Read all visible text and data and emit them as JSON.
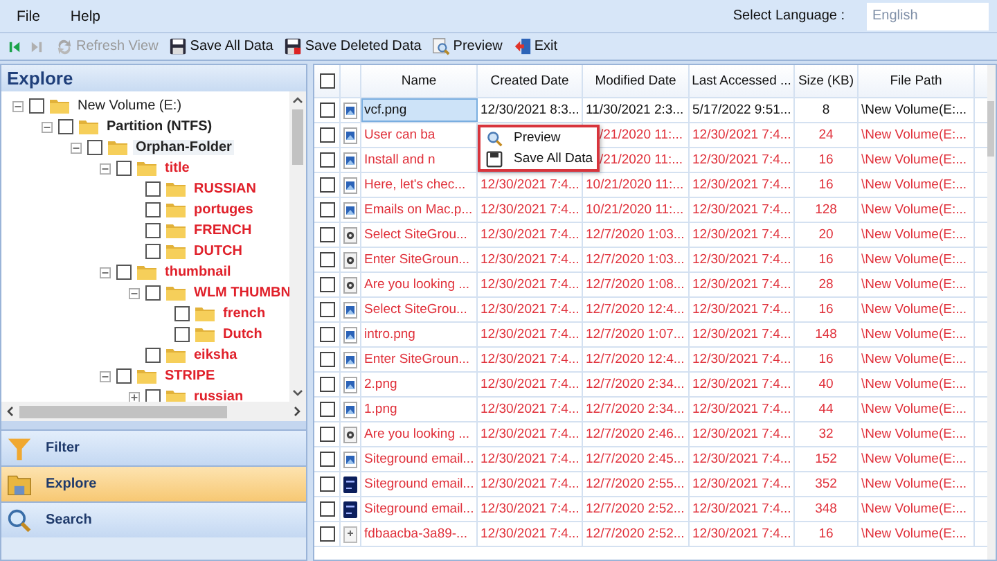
{
  "menu": [
    "File",
    "Help"
  ],
  "language": {
    "label": "Select Language :",
    "value": "English"
  },
  "toolbar": [
    {
      "kind": "first",
      "disabled": false
    },
    {
      "kind": "last",
      "disabled": true
    },
    {
      "kind": "refresh",
      "label": "Refresh View",
      "disabled": true
    },
    {
      "kind": "save",
      "label": "Save All Data",
      "disabled": false
    },
    {
      "kind": "save-deleted",
      "label": "Save Deleted Data",
      "disabled": false
    },
    {
      "kind": "preview",
      "label": "Preview",
      "disabled": false
    },
    {
      "kind": "exit",
      "label": "Exit",
      "disabled": false
    }
  ],
  "explore_panel": {
    "title": "Explore",
    "tree": [
      {
        "label": "New Volume (E:)",
        "deleted": false,
        "checked": false,
        "expanded": true,
        "selected": false,
        "children": [
          {
            "label": "Partition (NTFS)",
            "deleted": false,
            "checked": false,
            "expanded": true,
            "selected": false,
            "children": [
              {
                "label": "Orphan-Folder",
                "deleted": false,
                "checked": false,
                "expanded": true,
                "selected": true,
                "children": [
                  {
                    "label": "title",
                    "deleted": true,
                    "checked": false,
                    "expanded": true,
                    "selected": false,
                    "children": [
                      {
                        "label": "RUSSIAN",
                        "deleted": true,
                        "checked": false,
                        "selected": false
                      },
                      {
                        "label": "portuges",
                        "deleted": true,
                        "checked": false,
                        "selected": false
                      },
                      {
                        "label": "FRENCH",
                        "deleted": true,
                        "checked": false,
                        "selected": false
                      },
                      {
                        "label": "DUTCH",
                        "deleted": true,
                        "checked": false,
                        "selected": false
                      }
                    ]
                  },
                  {
                    "label": "thumbnail",
                    "deleted": true,
                    "checked": false,
                    "expanded": true,
                    "selected": false,
                    "children": [
                      {
                        "label": "WLM THUMBN",
                        "deleted": true,
                        "checked": false,
                        "expanded": true,
                        "selected": false,
                        "children": [
                          {
                            "label": "french",
                            "deleted": true,
                            "checked": false,
                            "selected": false
                          },
                          {
                            "label": "Dutch",
                            "deleted": true,
                            "checked": false,
                            "selected": false
                          }
                        ]
                      },
                      {
                        "label": "eiksha",
                        "deleted": true,
                        "checked": false,
                        "selected": false
                      }
                    ]
                  },
                  {
                    "label": "STRIPE",
                    "deleted": true,
                    "checked": false,
                    "expanded": true,
                    "selected": false,
                    "children": [
                      {
                        "label": "russian",
                        "deleted": true,
                        "checked": false,
                        "expanded": false,
                        "selected": false
                      }
                    ]
                  }
                ]
              }
            ]
          }
        ]
      }
    ]
  },
  "nav": [
    {
      "kind": "filter",
      "label": "Filter",
      "selected": false
    },
    {
      "kind": "explore",
      "label": "Explore",
      "selected": true
    },
    {
      "kind": "search",
      "label": "Search",
      "selected": false
    }
  ],
  "table": {
    "all_checked": false,
    "columns": [
      "Name",
      "Created Date",
      "Modified Date",
      "Last Accessed ...",
      "Size (KB)",
      "File Path"
    ],
    "rows": [
      {
        "kind": "image",
        "checked": false,
        "selected": true,
        "deleted": false,
        "name": "vcf.png",
        "created": "12/30/2021 8:3...",
        "modified": "11/30/2021 2:3...",
        "accessed": "5/17/2022 9:51...",
        "size": "8",
        "path": "\\New Volume(E:..."
      },
      {
        "kind": "image",
        "checked": false,
        "selected": false,
        "deleted": true,
        "name": "User can ba",
        "modified": "/21/2020 11:...",
        "accessed": "12/30/2021 7:4...",
        "size": "24",
        "path": "\\New Volume(E:..."
      },
      {
        "kind": "image",
        "checked": false,
        "selected": false,
        "deleted": true,
        "name": "Install and n",
        "modified": "/21/2020 11:...",
        "accessed": "12/30/2021 7:4...",
        "size": "16",
        "path": "\\New Volume(E:..."
      },
      {
        "kind": "image",
        "checked": false,
        "selected": false,
        "deleted": true,
        "name": "Here, let's chec...",
        "created": "12/30/2021 7:4...",
        "modified": "10/21/2020 11:...",
        "accessed": "12/30/2021 7:4...",
        "size": "16",
        "path": "\\New Volume(E:..."
      },
      {
        "kind": "image",
        "checked": false,
        "selected": false,
        "deleted": true,
        "name": "Emails on Mac.p...",
        "created": "12/30/2021 7:4...",
        "modified": "10/21/2020 11:...",
        "accessed": "12/30/2021 7:4...",
        "size": "128",
        "path": "\\New Volume(E:..."
      },
      {
        "kind": "gear",
        "checked": false,
        "selected": false,
        "deleted": true,
        "name": "Select SiteGrou...",
        "created": "12/30/2021 7:4...",
        "modified": "12/7/2020 1:03...",
        "accessed": "12/30/2021 7:4...",
        "size": "20",
        "path": "\\New Volume(E:..."
      },
      {
        "kind": "gear",
        "checked": false,
        "selected": false,
        "deleted": true,
        "name": "Enter SiteGroun...",
        "created": "12/30/2021 7:4...",
        "modified": "12/7/2020 1:03...",
        "accessed": "12/30/2021 7:4...",
        "size": "16",
        "path": "\\New Volume(E:..."
      },
      {
        "kind": "gear",
        "checked": false,
        "selected": false,
        "deleted": true,
        "name": "Are you looking ...",
        "created": "12/30/2021 7:4...",
        "modified": "12/7/2020 1:08...",
        "accessed": "12/30/2021 7:4...",
        "size": "28",
        "path": "\\New Volume(E:..."
      },
      {
        "kind": "image",
        "checked": false,
        "selected": false,
        "deleted": true,
        "name": "Select SiteGrou...",
        "created": "12/30/2021 7:4...",
        "modified": "12/7/2020 12:4...",
        "accessed": "12/30/2021 7:4...",
        "size": "16",
        "path": "\\New Volume(E:..."
      },
      {
        "kind": "image",
        "checked": false,
        "selected": false,
        "deleted": true,
        "name": "intro.png",
        "created": "12/30/2021 7:4...",
        "modified": "12/7/2020 1:07...",
        "accessed": "12/30/2021 7:4...",
        "size": "148",
        "path": "\\New Volume(E:..."
      },
      {
        "kind": "image",
        "checked": false,
        "selected": false,
        "deleted": true,
        "name": "Enter SiteGroun...",
        "created": "12/30/2021 7:4...",
        "modified": "12/7/2020 12:4...",
        "accessed": "12/30/2021 7:4...",
        "size": "16",
        "path": "\\New Volume(E:..."
      },
      {
        "kind": "image",
        "checked": false,
        "selected": false,
        "deleted": true,
        "name": "2.png",
        "created": "12/30/2021 7:4...",
        "modified": "12/7/2020 2:34...",
        "accessed": "12/30/2021 7:4...",
        "size": "40",
        "path": "\\New Volume(E:..."
      },
      {
        "kind": "image",
        "checked": false,
        "selected": false,
        "deleted": true,
        "name": "1.png",
        "created": "12/30/2021 7:4...",
        "modified": "12/7/2020 2:34...",
        "accessed": "12/30/2021 7:4...",
        "size": "44",
        "path": "\\New Volume(E:..."
      },
      {
        "kind": "gear",
        "checked": false,
        "selected": false,
        "deleted": true,
        "name": "Are you looking ...",
        "created": "12/30/2021 7:4...",
        "modified": "12/7/2020 2:46...",
        "accessed": "12/30/2021 7:4...",
        "size": "32",
        "path": "\\New Volume(E:..."
      },
      {
        "kind": "image",
        "checked": false,
        "selected": false,
        "deleted": true,
        "name": "Siteground email...",
        "created": "12/30/2021 7:4...",
        "modified": "12/7/2020 2:45...",
        "accessed": "12/30/2021 7:4...",
        "size": "152",
        "path": "\\New Volume(E:..."
      },
      {
        "kind": "video",
        "checked": false,
        "selected": false,
        "deleted": true,
        "name": "Siteground email...",
        "created": "12/30/2021 7:4...",
        "modified": "12/7/2020 2:55...",
        "accessed": "12/30/2021 7:4...",
        "size": "352",
        "path": "\\New Volume(E:..."
      },
      {
        "kind": "video",
        "checked": false,
        "selected": false,
        "deleted": true,
        "name": "Siteground email...",
        "created": "12/30/2021 7:4...",
        "modified": "12/7/2020 2:52...",
        "accessed": "12/30/2021 7:4...",
        "size": "348",
        "path": "\\New Volume(E:..."
      },
      {
        "kind": "file",
        "checked": false,
        "selected": false,
        "deleted": true,
        "name": "fdbaacba-3a89-...",
        "created": "12/30/2021 7:4...",
        "modified": "12/7/2020 2:52...",
        "accessed": "12/30/2021 7:4...",
        "size": "16",
        "path": "\\New Volume(E:..."
      }
    ]
  },
  "context_menu": [
    {
      "kind": "preview",
      "label": "Preview"
    },
    {
      "kind": "save",
      "label": "Save All Data"
    }
  ]
}
